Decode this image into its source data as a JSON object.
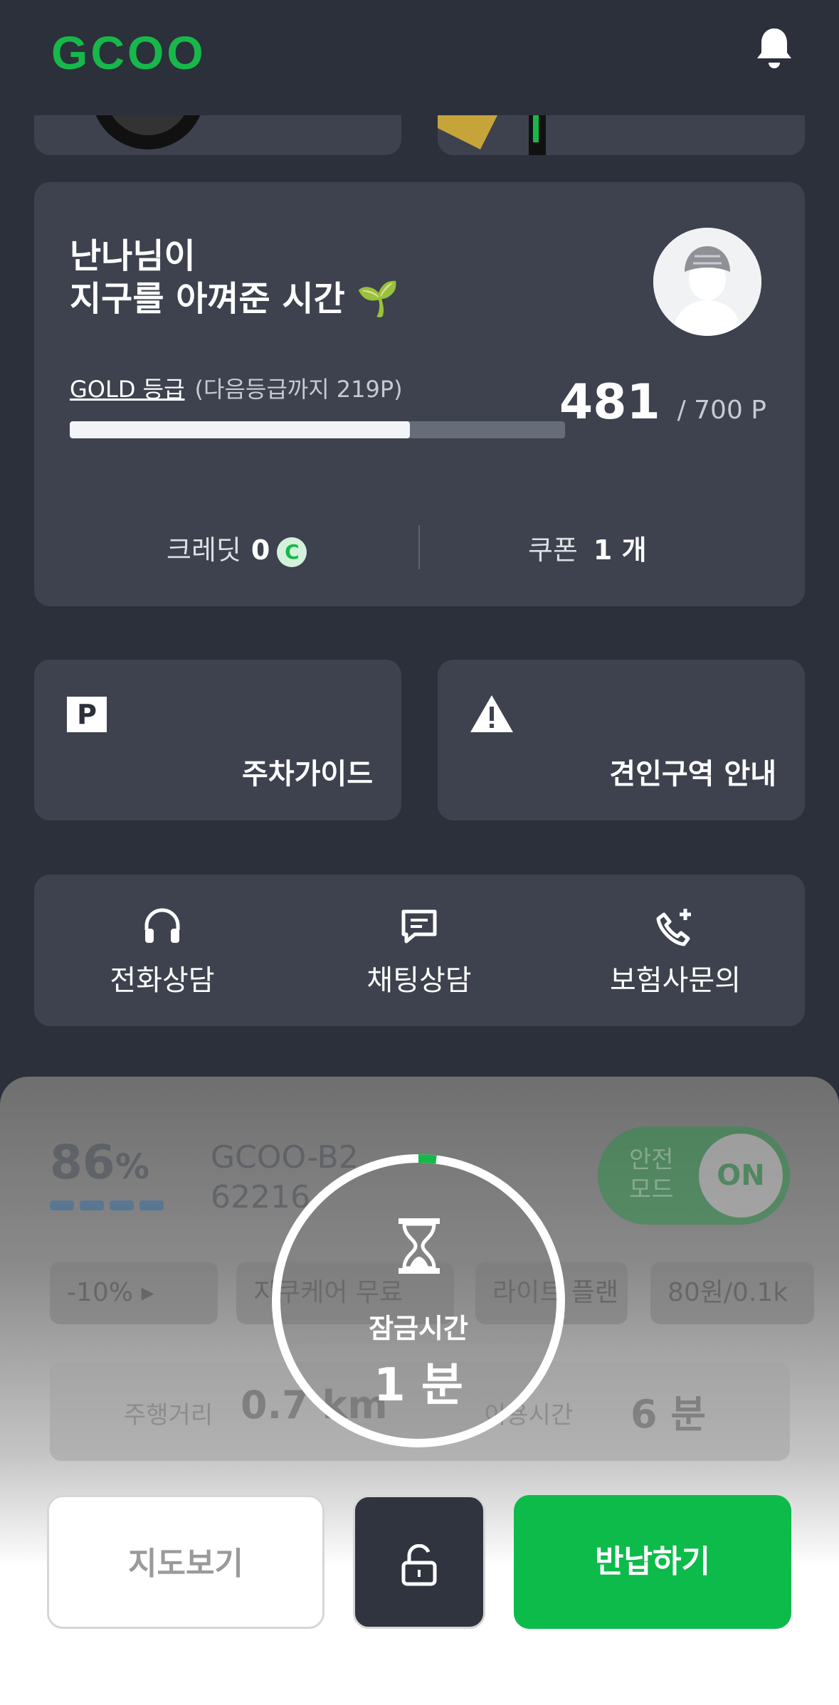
{
  "header": {
    "logo": "GCOO"
  },
  "profile": {
    "greeting_line1": "난나님이",
    "greeting_line2": "지구를 아껴준 시간 🌱",
    "grade": "GOLD 등급",
    "next_grade": "(다음등급까지 219P)",
    "points": "481",
    "points_max": "/ 700 P",
    "progress_fraction": 0.687,
    "credit_label": "크레딧",
    "credit_value": "0",
    "credit_symbol": "C",
    "coupon_label": "쿠폰",
    "coupon_value": "1 개"
  },
  "guides": {
    "parking_icon_text": "P",
    "parking_label": "주차가이드",
    "tow_label": "견인구역 안내"
  },
  "support": {
    "phone": "전화상담",
    "chat": "채팅상담",
    "insurance": "보험사문의"
  },
  "ride": {
    "battery": "86",
    "battery_unit": "%",
    "device_name": "GCOO-B2",
    "device_id": "62216",
    "safe_mode_label": "안전\n모드",
    "safe_mode_state": "ON",
    "chips": [
      "-10%",
      "지쿠케어 무료",
      "라이트 플랜",
      "80원/0.1k"
    ],
    "distance_label": "주행거리",
    "distance_value": "0.7 km",
    "time_label": "이용시간",
    "time_value": "6 분"
  },
  "lock_timer": {
    "label": "잠금시간",
    "value": "1 분",
    "progress_fraction": 0.02
  },
  "actions": {
    "map": "지도보기",
    "return": "반납하기"
  },
  "colors": {
    "brand_green": "#17b84a",
    "background": "#2b303a",
    "card": "#3d424e",
    "return_button": "#0dbb4b"
  }
}
